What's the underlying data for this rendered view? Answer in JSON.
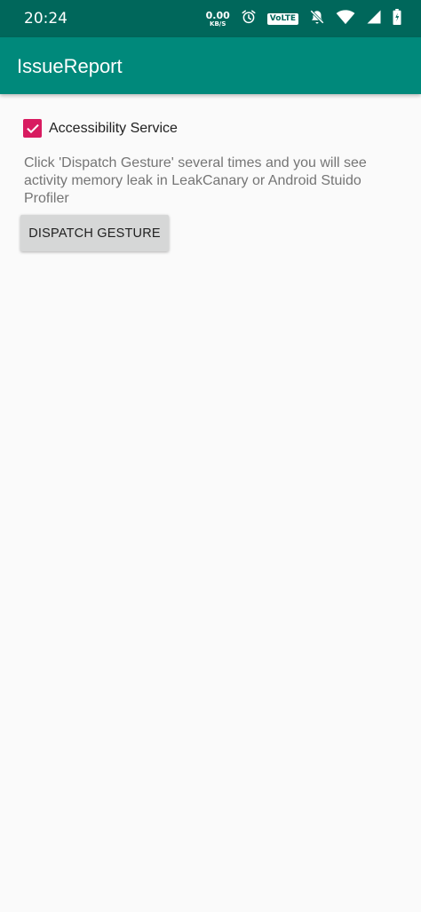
{
  "status_bar": {
    "time": "20:24",
    "network_speed_value": "0.00",
    "network_speed_unit": "KB/S",
    "volte_label": "VoLTE",
    "icons": [
      "alarm-icon",
      "volte-icon",
      "mute-icon",
      "wifi-icon",
      "signal-icon",
      "battery-icon"
    ]
  },
  "app_bar": {
    "title": "IssueReport",
    "color": "#00897b"
  },
  "main": {
    "checkbox": {
      "label": "Accessibility Service",
      "checked": true,
      "color": "#d81b60"
    },
    "description": "Click 'Dispatch Gesture' several times and you will see activity memory leak in LeakCanary or Android Stuido Profiler",
    "button_label": "DISPATCH GESTURE"
  }
}
